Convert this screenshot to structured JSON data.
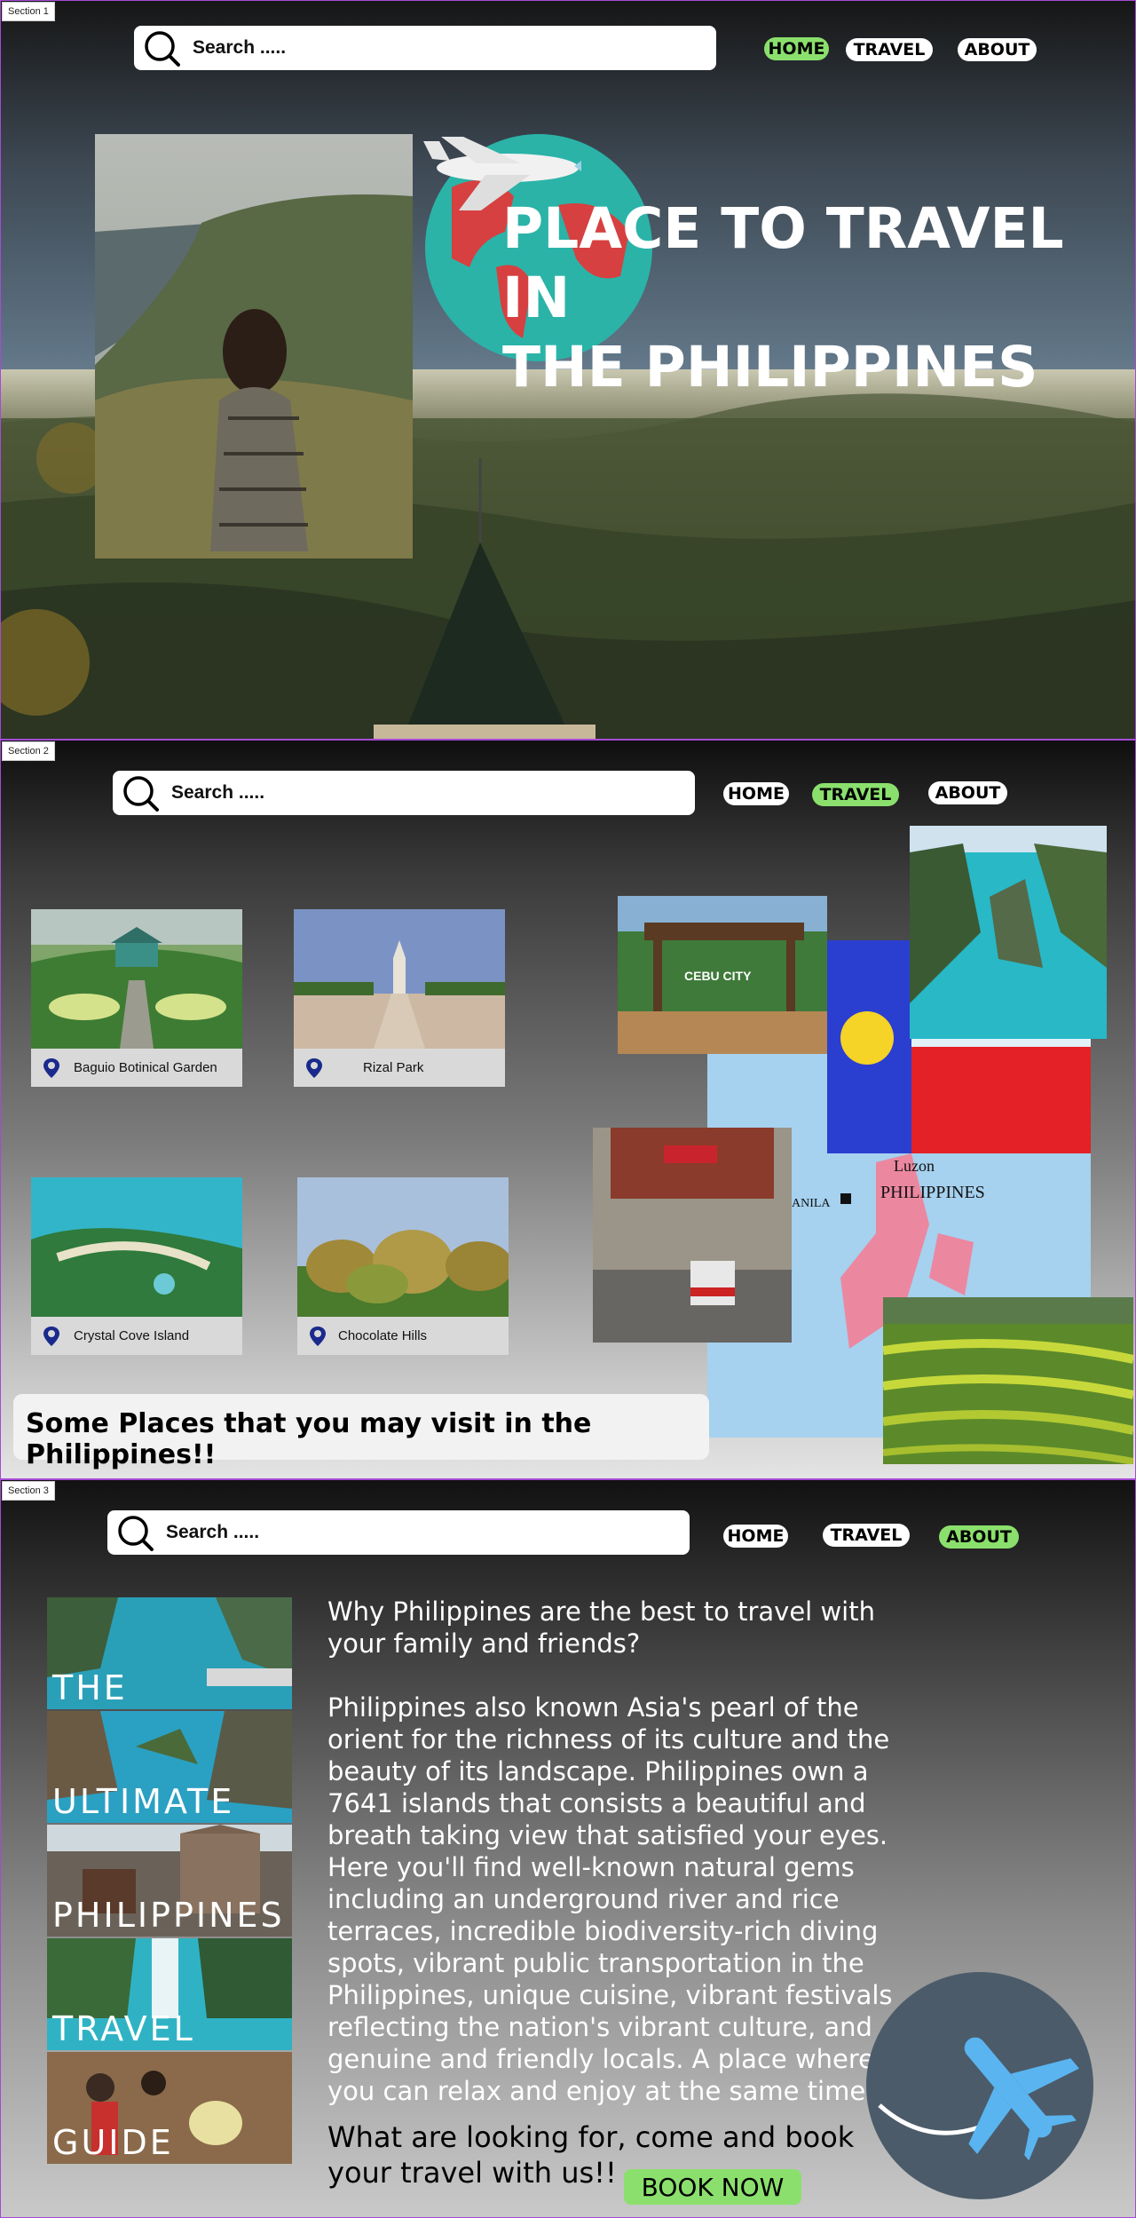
{
  "sections": [
    "Section 1",
    "Section 2",
    "Section 3"
  ],
  "search": {
    "placeholder": "Search ....."
  },
  "nav": {
    "home": "HOME",
    "travel": "TRAVEL",
    "about": "ABOUT"
  },
  "hero": {
    "title_line1": "PLACE TO TRAVEL IN",
    "title_line2": "THE PHILIPPINES"
  },
  "places": [
    {
      "label": "Baguio Botinical Garden"
    },
    {
      "label": "Rizal Park"
    },
    {
      "label": "Crystal Cove Island"
    },
    {
      "label": "Chocolate Hills"
    }
  ],
  "collage": {
    "map_label_country": "PHILIPPINES",
    "map_label_region": "Luzon",
    "map_label_city": "ANILA",
    "gate_sign": "CEBU CITY"
  },
  "section2_caption": "Some Places that you may visit in the Philippines!!",
  "about": {
    "question": "Why Philippines are the best to travel with your family and friends?",
    "paragraph": "Philippines also known Asia's pearl of the orient for the richness of its culture and the beauty of its landscape. Philippines own a 7641 islands that consists a beautiful and breath taking view that satisfied your eyes. Here you'll find well-known natural gems including an underground river and rice terraces, incredible biodiversity-rich diving spots, vibrant public transportation in the Philippines, unique cuisine, vibrant festivals reflecting the nation's vibrant culture, and genuine and friendly locals. A place where you can relax and enjoy at the same time.",
    "cta_question": "What  are looking for, come and book your travel with us!!",
    "book_button": "BOOK NOW"
  },
  "guide_words": [
    "THE",
    "ULTIMATE",
    "PHILIPPINES",
    "TRAVEL",
    "GUIDE"
  ],
  "colors": {
    "active_nav": "#8be06d",
    "section_border": "#a64ad6",
    "pin": "#1a2a8c",
    "plane": "#5ab4ef"
  }
}
